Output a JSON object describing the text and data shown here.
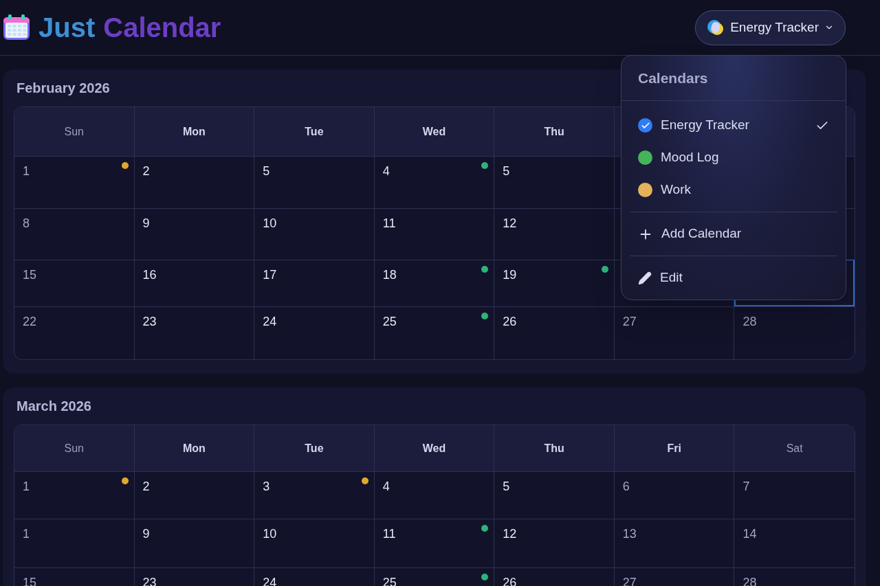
{
  "app": {
    "title_parts": [
      "Just",
      "Calendar"
    ]
  },
  "calendar_picker": {
    "label": "Energy Tracker",
    "expanded": true
  },
  "dropdown": {
    "heading": "Calendars",
    "calendars": [
      {
        "label": "Energy Tracker",
        "color": "#2f7cf6",
        "selected": true
      },
      {
        "label": "Mood Log",
        "color": "#45b35a",
        "selected": false
      },
      {
        "label": "Work",
        "color": "#e5b25a",
        "selected": false
      }
    ],
    "actions": [
      {
        "kind": "add",
        "label": "Add Calendar"
      },
      {
        "kind": "edit",
        "label": "Edit"
      }
    ]
  },
  "months": [
    {
      "title": "February 2026",
      "headers": [
        "Sun",
        "Mon",
        "Tue",
        "Wed",
        "Thu"
      ],
      "rows": [
        [
          {
            "day": "1",
            "color": "#e0a82e",
            "highlighted": false
          },
          {
            "day": "2",
            "highlighted": false
          },
          {
            "day": "5",
            "highlighted": false
          },
          {
            "day": "4",
            "color": "#2fb27a",
            "highlighted": false
          },
          {
            "day": "5",
            "highlighted": false
          },
          {
            "highlighted": false
          },
          {
            "highlighted": false
          }
        ],
        [
          {
            "day": "8",
            "highlighted": false
          },
          {
            "day": "9",
            "highlighted": false
          },
          {
            "day": "10",
            "highlighted": false
          },
          {
            "day": "11",
            "highlighted": false
          },
          {
            "day": "12",
            "highlighted": false
          },
          {
            "highlighted": false
          },
          {
            "highlighted": false
          }
        ],
        [
          {
            "day": "15",
            "highlighted": false
          },
          {
            "day": "16",
            "highlighted": false
          },
          {
            "day": "17",
            "highlighted": false
          },
          {
            "day": "18",
            "color": "#2fb27a",
            "highlighted": false
          },
          {
            "day": "19",
            "color": "#2fb27a",
            "highlighted": false
          },
          {
            "highlighted": false
          },
          {
            "highlighted": true
          }
        ],
        [
          {
            "day": "22",
            "highlighted": false
          },
          {
            "day": "23",
            "highlighted": false
          },
          {
            "day": "24",
            "highlighted": false
          },
          {
            "day": "25",
            "color": "#2fb27a",
            "highlighted": false
          },
          {
            "day": "26",
            "highlighted": false
          },
          {
            "day": "27",
            "highlighted": false
          },
          {
            "day": "28",
            "highlighted": false
          }
        ]
      ]
    },
    {
      "title": "March 2026",
      "headers": [
        "Sun",
        "Mon",
        "Tue",
        "Wed",
        "Thu",
        "Fri",
        "Sat"
      ],
      "rows": [
        [
          {
            "day": "1",
            "color": "#e0a82e",
            "highlighted": false
          },
          {
            "day": "2",
            "highlighted": false
          },
          {
            "day": "3",
            "color": "#e0a82e",
            "highlighted": false
          },
          {
            "day": "4",
            "highlighted": false
          },
          {
            "day": "5",
            "highlighted": false
          },
          {
            "day": "6",
            "highlighted": false
          },
          {
            "day": "7",
            "highlighted": false
          }
        ],
        [
          {
            "day": "1",
            "highlighted": false
          },
          {
            "day": "9",
            "highlighted": false
          },
          {
            "day": "10",
            "highlighted": false
          },
          {
            "day": "11",
            "color": "#2fb27a",
            "highlighted": false
          },
          {
            "day": "12",
            "highlighted": false
          },
          {
            "day": "13",
            "highlighted": false
          },
          {
            "day": "14",
            "highlighted": false
          }
        ],
        [
          {
            "day": "15",
            "highlighted": false
          },
          {
            "day": "23",
            "highlighted": false
          },
          {
            "day": "24",
            "highlighted": false
          },
          {
            "day": "25",
            "color": "#2fb27a",
            "highlighted": false
          },
          {
            "day": "26",
            "highlighted": false
          },
          {
            "day": "27",
            "highlighted": false
          },
          {
            "day": "28",
            "highlighted": false
          }
        ]
      ]
    }
  ]
}
